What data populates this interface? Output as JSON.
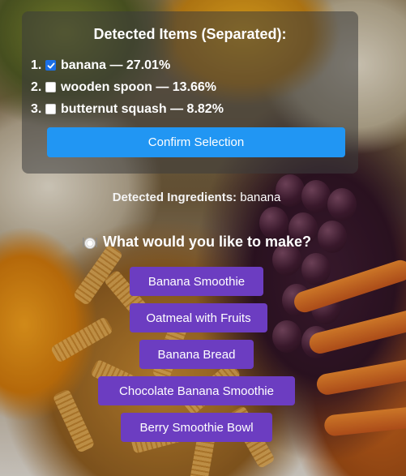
{
  "panel": {
    "title": "Detected Items (Separated):",
    "items": [
      {
        "num": "1.",
        "label": "banana — 27.01%",
        "checked": true
      },
      {
        "num": "2.",
        "label": "wooden spoon — 13.66%",
        "checked": false
      },
      {
        "num": "3.",
        "label": "butternut squash — 8.82%",
        "checked": false
      }
    ],
    "confirm_label": "Confirm Selection"
  },
  "ingredients": {
    "label": "Detected Ingredients:",
    "value": "banana"
  },
  "question": {
    "icon": "plate-cutlery-icon",
    "text": "What would you like to make?"
  },
  "choices": [
    "Banana Smoothie",
    "Oatmeal with Fruits",
    "Banana Bread",
    "Chocolate Banana Smoothie",
    "Berry Smoothie Bowl"
  ],
  "colors": {
    "confirm_button": "#2196f3",
    "choice_button": "#6c3dc1",
    "checkbox_checked": "#1a6fe6"
  }
}
